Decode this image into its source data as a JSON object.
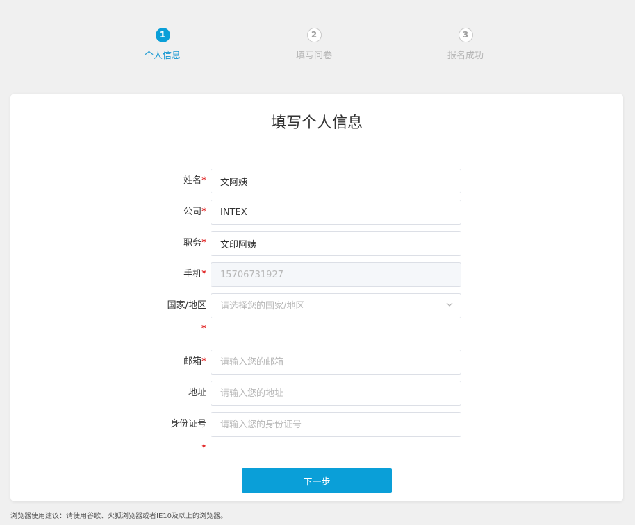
{
  "steps": [
    {
      "number": "1",
      "label": "个人信息",
      "state": "active"
    },
    {
      "number": "2",
      "label": "填写问卷",
      "state": "inactive"
    },
    {
      "number": "3",
      "label": "报名成功",
      "state": "inactive"
    }
  ],
  "form": {
    "title": "填写个人信息",
    "required_mark": "*",
    "fields": {
      "name": {
        "label": "姓名",
        "value": "文阿姨",
        "placeholder": ""
      },
      "company": {
        "label": "公司",
        "value": "INTEX",
        "placeholder": ""
      },
      "position": {
        "label": "职务",
        "value": "文印阿姨",
        "placeholder": ""
      },
      "phone": {
        "label": "手机",
        "value": "15706731927",
        "placeholder": ""
      },
      "country": {
        "label": "国家/地区",
        "value": "",
        "placeholder": "请选择您的国家/地区"
      },
      "email": {
        "label": "邮箱",
        "value": "",
        "placeholder": "请输入您的邮箱"
      },
      "address": {
        "label": "地址",
        "value": "",
        "placeholder": "请输入您的地址"
      },
      "id_number": {
        "label": "身份证号",
        "value": "",
        "placeholder": "请输入您的身份证号"
      }
    },
    "next_label": "下一步"
  },
  "footer": {
    "browser_note": "浏览器使用建议：请使用谷歌、火狐浏览器或者IE10及以上的浏览器。"
  },
  "colors": {
    "accent": "#0a9fd8",
    "required": "#e02020"
  },
  "icons": {
    "select_arrow": "chevron-down-icon"
  }
}
